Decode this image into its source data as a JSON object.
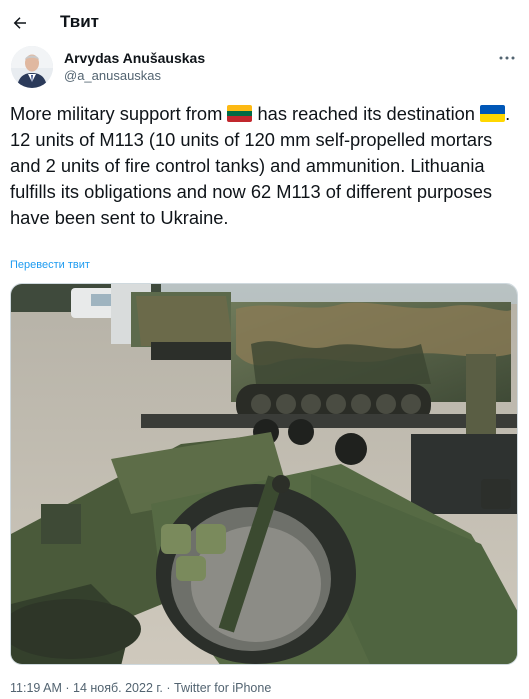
{
  "header": {
    "title": "Твит",
    "back_icon": "arrow-left-icon"
  },
  "author": {
    "name": "Arvydas Anušauskas",
    "handle": "@a_anusauskas"
  },
  "more_icon": "more-horizontal-icon",
  "tweet": {
    "text_part1": "More military support from ",
    "flag1": "Lithuania flag",
    "text_part2": " has reached its destination ",
    "flag2": "Ukraine flag",
    "text_part3": ". 12 units of M113 (10 units of 120 mm self-propelled mortars and 2 units of fire control tanks) and ammunition. Lithuania fulfills its obligations and now 62 M113 of different purposes have been sent to Ukraine."
  },
  "translate_label": "Перевести твит",
  "meta": {
    "time": "11:19 AM",
    "separator": " · ",
    "date": "14 нояб. 2022 г.",
    "source": "Twitter for iPhone"
  },
  "colors": {
    "link": "#1d9bf0",
    "secondary": "#536471",
    "text": "#0f1419"
  }
}
